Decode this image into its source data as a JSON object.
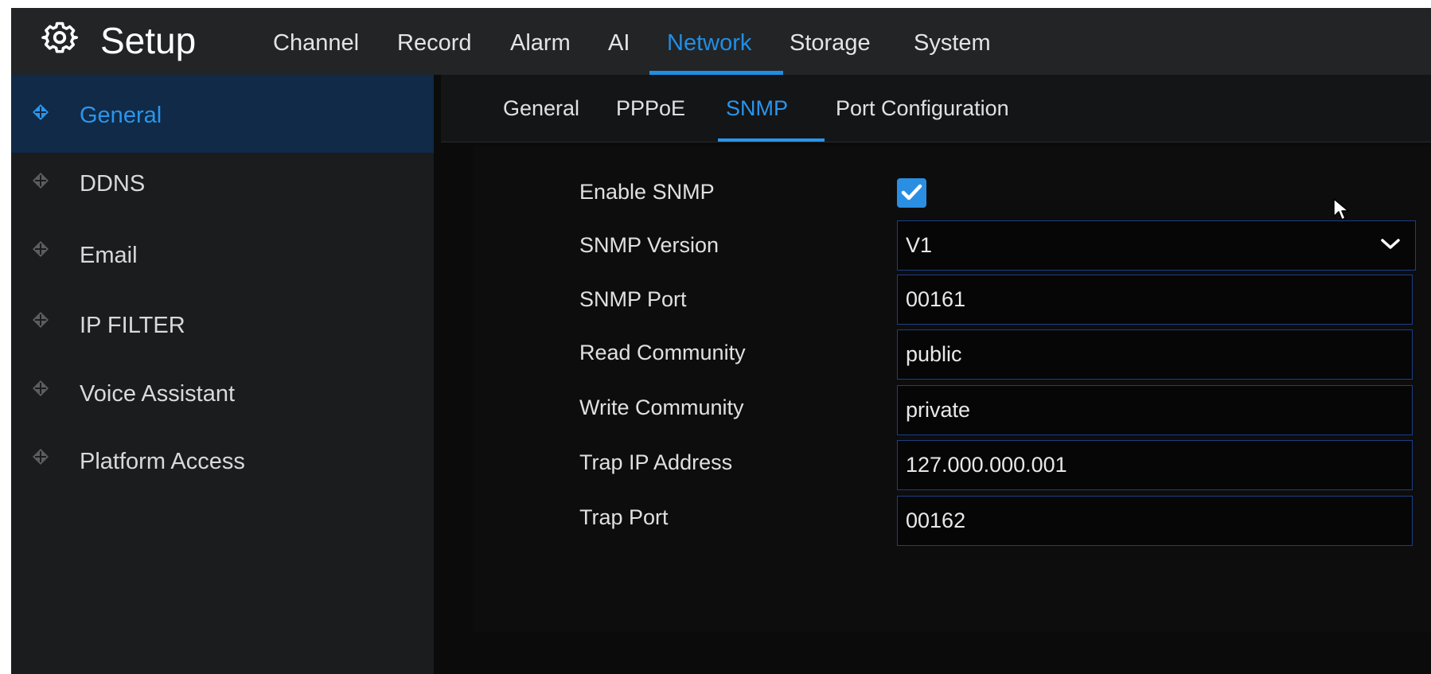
{
  "header": {
    "title": "Setup",
    "tabs": [
      {
        "label": "Channel"
      },
      {
        "label": "Record"
      },
      {
        "label": "Alarm"
      },
      {
        "label": "AI"
      },
      {
        "label": "Network"
      },
      {
        "label": "Storage"
      },
      {
        "label": "System"
      }
    ],
    "active_tab": "Network"
  },
  "sidebar": {
    "items": [
      {
        "label": "General"
      },
      {
        "label": "DDNS"
      },
      {
        "label": "Email"
      },
      {
        "label": "IP FILTER"
      },
      {
        "label": "Voice Assistant"
      },
      {
        "label": "Platform Access"
      }
    ],
    "active_item": "General"
  },
  "subtabs": {
    "items": [
      {
        "label": "General"
      },
      {
        "label": "PPPoE"
      },
      {
        "label": "SNMP"
      },
      {
        "label": "Port Configuration"
      }
    ],
    "active": "SNMP"
  },
  "form": {
    "enable_snmp": {
      "label": "Enable SNMP",
      "checked": true
    },
    "snmp_version": {
      "label": "SNMP Version",
      "value": "V1"
    },
    "snmp_port": {
      "label": "SNMP Port",
      "value": "00161"
    },
    "read_community": {
      "label": "Read Community",
      "value": "public"
    },
    "write_community": {
      "label": "Write Community",
      "value": "private"
    },
    "trap_ip": {
      "label": "Trap IP Address",
      "value": "127.000.000.001"
    },
    "trap_port": {
      "label": "Trap Port",
      "value": "00162"
    }
  },
  "colors": {
    "accent": "#1f8fe6",
    "active_sidebar_bg": "#102a47",
    "field_border": "#1c3f86",
    "checkbox": "#2a8fe2"
  },
  "icons": {
    "app": "gear-icon",
    "sidebar_bullet": "diamond-crosshair-icon",
    "select": "chevron-down-icon",
    "checkbox": "checkmark-icon",
    "pointer": "mouse-cursor-icon"
  }
}
